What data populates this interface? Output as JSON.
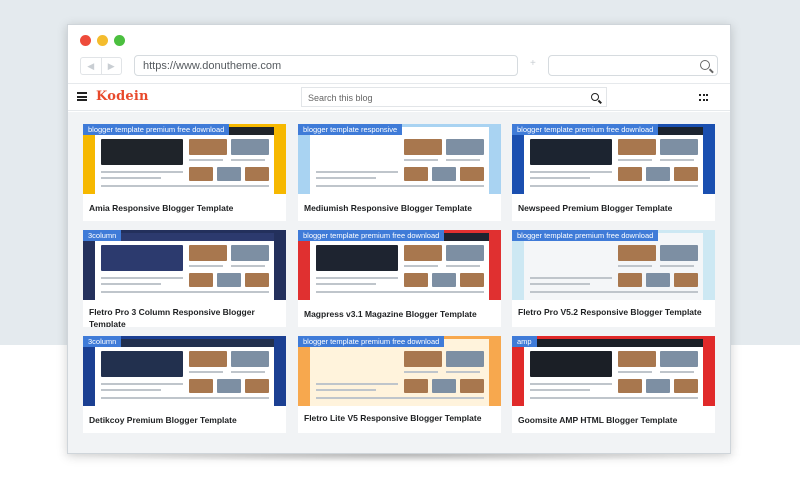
{
  "browser": {
    "url": "https://www.donutheme.com",
    "nav_back_icon": "arrow-left-icon",
    "nav_forward_icon": "arrow-right-icon",
    "separator": "+"
  },
  "site": {
    "logo": "Kodein",
    "search_placeholder": "Search this blog"
  },
  "colors": {
    "logo": "#e8492b",
    "tag": "#3f7bd8",
    "dot_red": "#ee4b3b",
    "dot_yellow": "#f4bc2d",
    "dot_green": "#4bbf3f"
  },
  "cards": [
    {
      "tag": "blogger template premium free download",
      "title": "Amia Responsive Blogger Template",
      "accent": "#f6b800",
      "dark": "#1f242a"
    },
    {
      "tag": "blogger template responsive",
      "title": "Mediumish Responsive Blogger Template",
      "accent": "#a9d3f2",
      "dark": "#ffffff"
    },
    {
      "tag": "blogger template premium free download",
      "title": "Newspeed Premium Blogger Template",
      "accent": "#1a4fb0",
      "dark": "#1c2430"
    },
    {
      "tag": "3column",
      "title": "Fletro Pro 3 Column Responsive Blogger Template",
      "accent": "#23305c",
      "dark": "#2c3a6e"
    },
    {
      "tag": "blogger template premium free download",
      "title": "Magpress v3.1 Magazine Blogger Template",
      "accent": "#e03030",
      "dark": "#1e2430"
    },
    {
      "tag": "blogger template premium free download",
      "title": "Fletro Pro V5.2 Responsive Blogger Template",
      "accent": "#cde8f3",
      "dark": "#f4f6f8"
    },
    {
      "tag": "3column",
      "title": "Detikcoy Premium Blogger Template",
      "accent": "#1b3f92",
      "dark": "#22304e"
    },
    {
      "tag": "blogger template premium free download",
      "title": "Fletro Lite V5 Responsive Blogger Template",
      "accent": "#f7a84e",
      "dark": "#fff3dc"
    },
    {
      "tag": "amp",
      "title": "Goomsite AMP HTML Blogger Template",
      "accent": "#e02a2a",
      "dark": "#1b1f26"
    }
  ]
}
